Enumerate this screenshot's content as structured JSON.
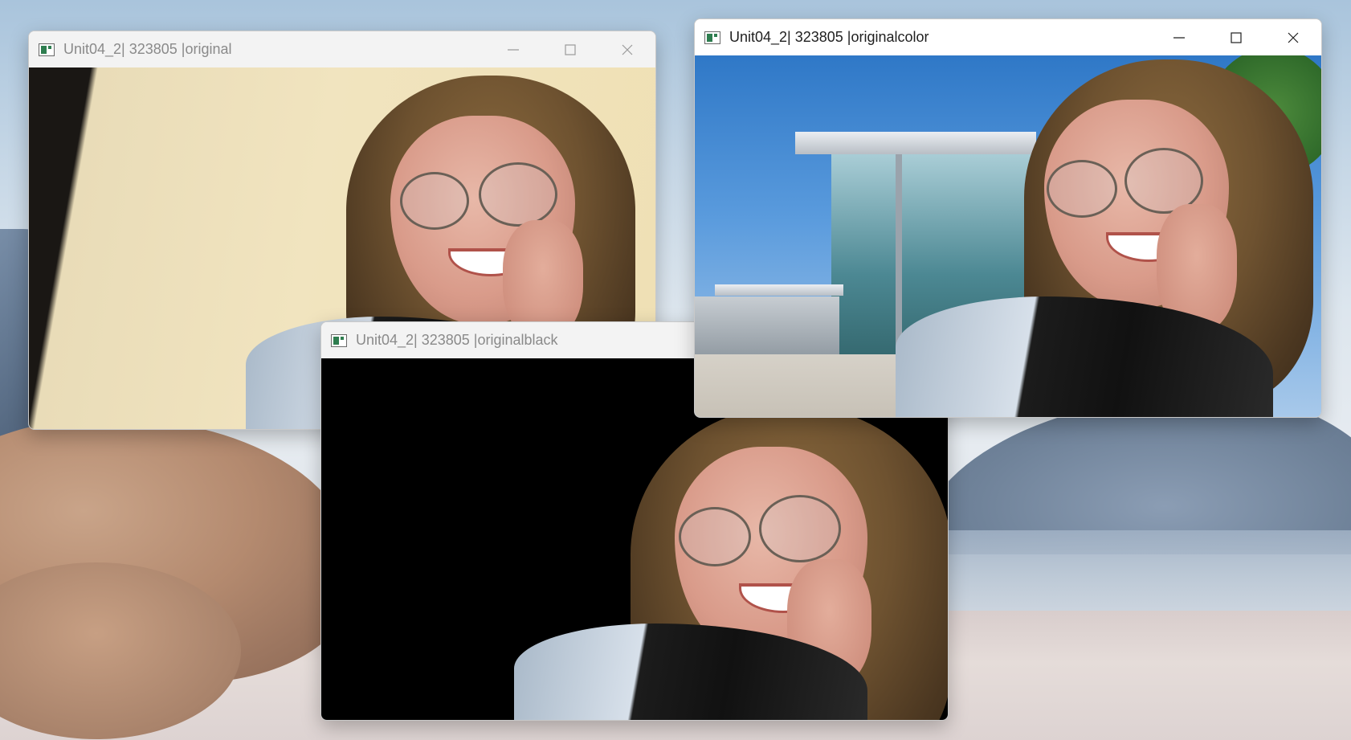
{
  "windows": [
    {
      "title": "Unit04_2| 323805 |original",
      "active": false
    },
    {
      "title": "Unit04_2| 323805 |originalblack",
      "active": false
    },
    {
      "title": "Unit04_2| 323805 |originalcolor",
      "active": true
    }
  ],
  "controls": {
    "minimize": "—",
    "maximize": "☐",
    "close": "✕"
  }
}
